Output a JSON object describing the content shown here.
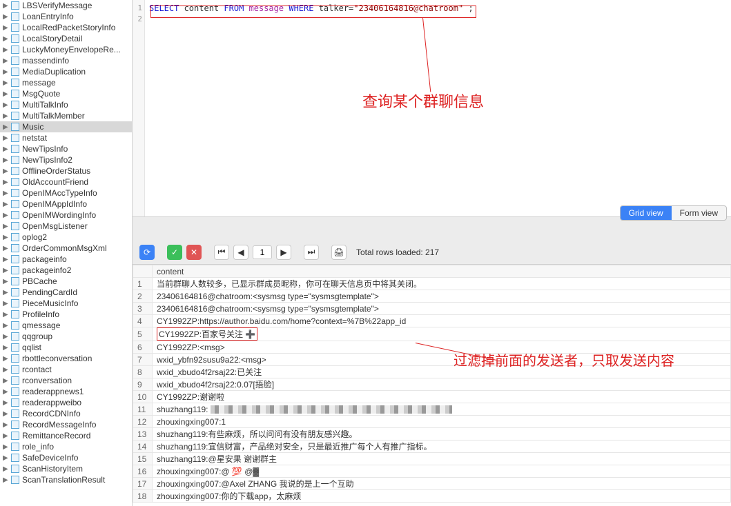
{
  "sidebar": {
    "selected_index": 11,
    "items": [
      {
        "label": "LBSVerifyMessage"
      },
      {
        "label": "LoanEntryInfo"
      },
      {
        "label": "LocalRedPacketStoryInfo"
      },
      {
        "label": "LocalStoryDetail"
      },
      {
        "label": "LuckyMoneyEnvelopeRe..."
      },
      {
        "label": "massendinfo"
      },
      {
        "label": "MediaDuplication"
      },
      {
        "label": "message"
      },
      {
        "label": "MsgQuote"
      },
      {
        "label": "MultiTalkInfo"
      },
      {
        "label": "MultiTalkMember"
      },
      {
        "label": "Music"
      },
      {
        "label": "netstat"
      },
      {
        "label": "NewTipsInfo"
      },
      {
        "label": "NewTipsInfo2"
      },
      {
        "label": "OfflineOrderStatus"
      },
      {
        "label": "OldAccountFriend"
      },
      {
        "label": "OpenIMAccTypeInfo"
      },
      {
        "label": "OpenIMAppIdInfo"
      },
      {
        "label": "OpenIMWordingInfo"
      },
      {
        "label": "OpenMsgListener"
      },
      {
        "label": "oplog2"
      },
      {
        "label": "OrderCommonMsgXml"
      },
      {
        "label": "packageinfo"
      },
      {
        "label": "packageinfo2"
      },
      {
        "label": "PBCache"
      },
      {
        "label": "PendingCardId"
      },
      {
        "label": "PieceMusicInfo"
      },
      {
        "label": "ProfileInfo"
      },
      {
        "label": "qmessage"
      },
      {
        "label": "qqgroup"
      },
      {
        "label": "qqlist"
      },
      {
        "label": "rbottleconversation"
      },
      {
        "label": "rcontact"
      },
      {
        "label": "rconversation"
      },
      {
        "label": "readerappnews1"
      },
      {
        "label": "readerappweibo"
      },
      {
        "label": "RecordCDNInfo"
      },
      {
        "label": "RecordMessageInfo"
      },
      {
        "label": "RemittanceRecord"
      },
      {
        "label": "role_info"
      },
      {
        "label": "SafeDeviceInfo"
      },
      {
        "label": "ScanHistoryItem"
      },
      {
        "label": "ScanTranslationResult"
      }
    ]
  },
  "editor": {
    "line_numbers": [
      "1",
      "2"
    ],
    "sql_tokens": [
      {
        "t": "SELECT",
        "c": "blue"
      },
      {
        "t": " content ",
        "c": "txt"
      },
      {
        "t": "FROM",
        "c": "blue"
      },
      {
        "t": " ",
        "c": "txt"
      },
      {
        "t": "message",
        "c": "purple"
      },
      {
        "t": " ",
        "c": "txt"
      },
      {
        "t": "WHERE",
        "c": "blue"
      },
      {
        "t": " talker=",
        "c": "txt"
      },
      {
        "t": "\"23406164816@chatroom\"",
        "c": "darkred"
      },
      {
        "t": " ;",
        "c": "txt"
      }
    ]
  },
  "annotations": {
    "callout1": "查询某个群聊信息",
    "callout2": "过滤掉前面的发送者，只取发送内容"
  },
  "view_tabs": {
    "grid": "Grid view",
    "form": "Form view",
    "active": "grid"
  },
  "toolbar": {
    "page_value": "1",
    "total_rows_label": "Total rows loaded: 217"
  },
  "grid": {
    "column_header": "content",
    "highlight_row_index": 4,
    "rows": [
      {
        "n": "1",
        "v": "当前群聊人数较多，已显示群成员昵称，你可在聊天信息页中将其关闭。"
      },
      {
        "n": "2",
        "v": "23406164816@chatroom:<sysmsg type=\"sysmsgtemplate\">"
      },
      {
        "n": "3",
        "v": "23406164816@chatroom:<sysmsg type=\"sysmsgtemplate\">"
      },
      {
        "n": "4",
        "v": "CY1992ZP:https://author.baidu.com/home?context=%7B%22app_id"
      },
      {
        "n": "5",
        "v": "CY1992ZP:百家号关注 ➕"
      },
      {
        "n": "6",
        "v": "CY1992ZP:<msg>"
      },
      {
        "n": "7",
        "v": "wxid_ybfn92susu9a22:<msg>"
      },
      {
        "n": "8",
        "v": "wxid_xbudo4f2rsaj22:已关注"
      },
      {
        "n": "9",
        "v": "wxid_xbudo4f2rsaj22:0.07[捂脸]"
      },
      {
        "n": "10",
        "v": "CY1992ZP:谢谢啦"
      },
      {
        "n": "11",
        "v": "shuzhang119: ▓▓░░▒▒░░▓▓▒▒░░",
        "pix": true
      },
      {
        "n": "12",
        "v": "zhouxingxing007:1"
      },
      {
        "n": "13",
        "v": "shuzhang119:有些麻烦，所以问问有没有朋友感兴趣。"
      },
      {
        "n": "14",
        "v": "shuzhang119:宜信财富，产品绝对安全，只是最近推广每个人有推广指标。"
      },
      {
        "n": "15",
        "v": "shuzhang119:@星安果 谢谢群主"
      },
      {
        "n": "16",
        "v": "zhouxingxing007:@ 💯 @▓"
      },
      {
        "n": "17",
        "v": "zhouxingxing007:@Axel ZHANG 我说的是上一个互助"
      },
      {
        "n": "18",
        "v": "zhouxingxing007:你的下载app，太麻烦"
      }
    ]
  }
}
